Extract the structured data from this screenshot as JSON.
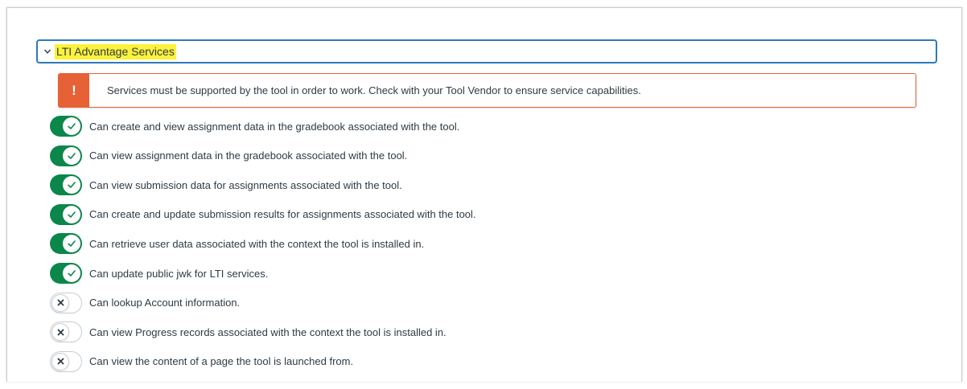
{
  "section": {
    "title": "LTI Advantage Services",
    "expanded": true,
    "chevron_icon": "chevron-down-icon"
  },
  "alert": {
    "icon_glyph": "!",
    "icon": "warning-icon",
    "text": "Services must be supported by the tool in order to work. Check with your Tool Vendor to ensure service capabilities.",
    "color": "#e66135"
  },
  "colors": {
    "toggle_on": "#0b874b",
    "header_border": "#2b7abc",
    "highlight": "#fcf23a"
  },
  "services": [
    {
      "label": "Can create and view assignment data in the gradebook associated with the tool.",
      "enabled": true
    },
    {
      "label": "Can view assignment data in the gradebook associated with the tool.",
      "enabled": true
    },
    {
      "label": "Can view submission data for assignments associated with the tool.",
      "enabled": true
    },
    {
      "label": "Can create and update submission results for assignments associated with the tool.",
      "enabled": true
    },
    {
      "label": "Can retrieve user data associated with the context the tool is installed in.",
      "enabled": true
    },
    {
      "label": "Can update public jwk for LTI services.",
      "enabled": true
    },
    {
      "label": "Can lookup Account information.",
      "enabled": false
    },
    {
      "label": "Can view Progress records associated with the context the tool is installed in.",
      "enabled": false
    },
    {
      "label": "Can view the content of a page the tool is launched from.",
      "enabled": false
    }
  ]
}
